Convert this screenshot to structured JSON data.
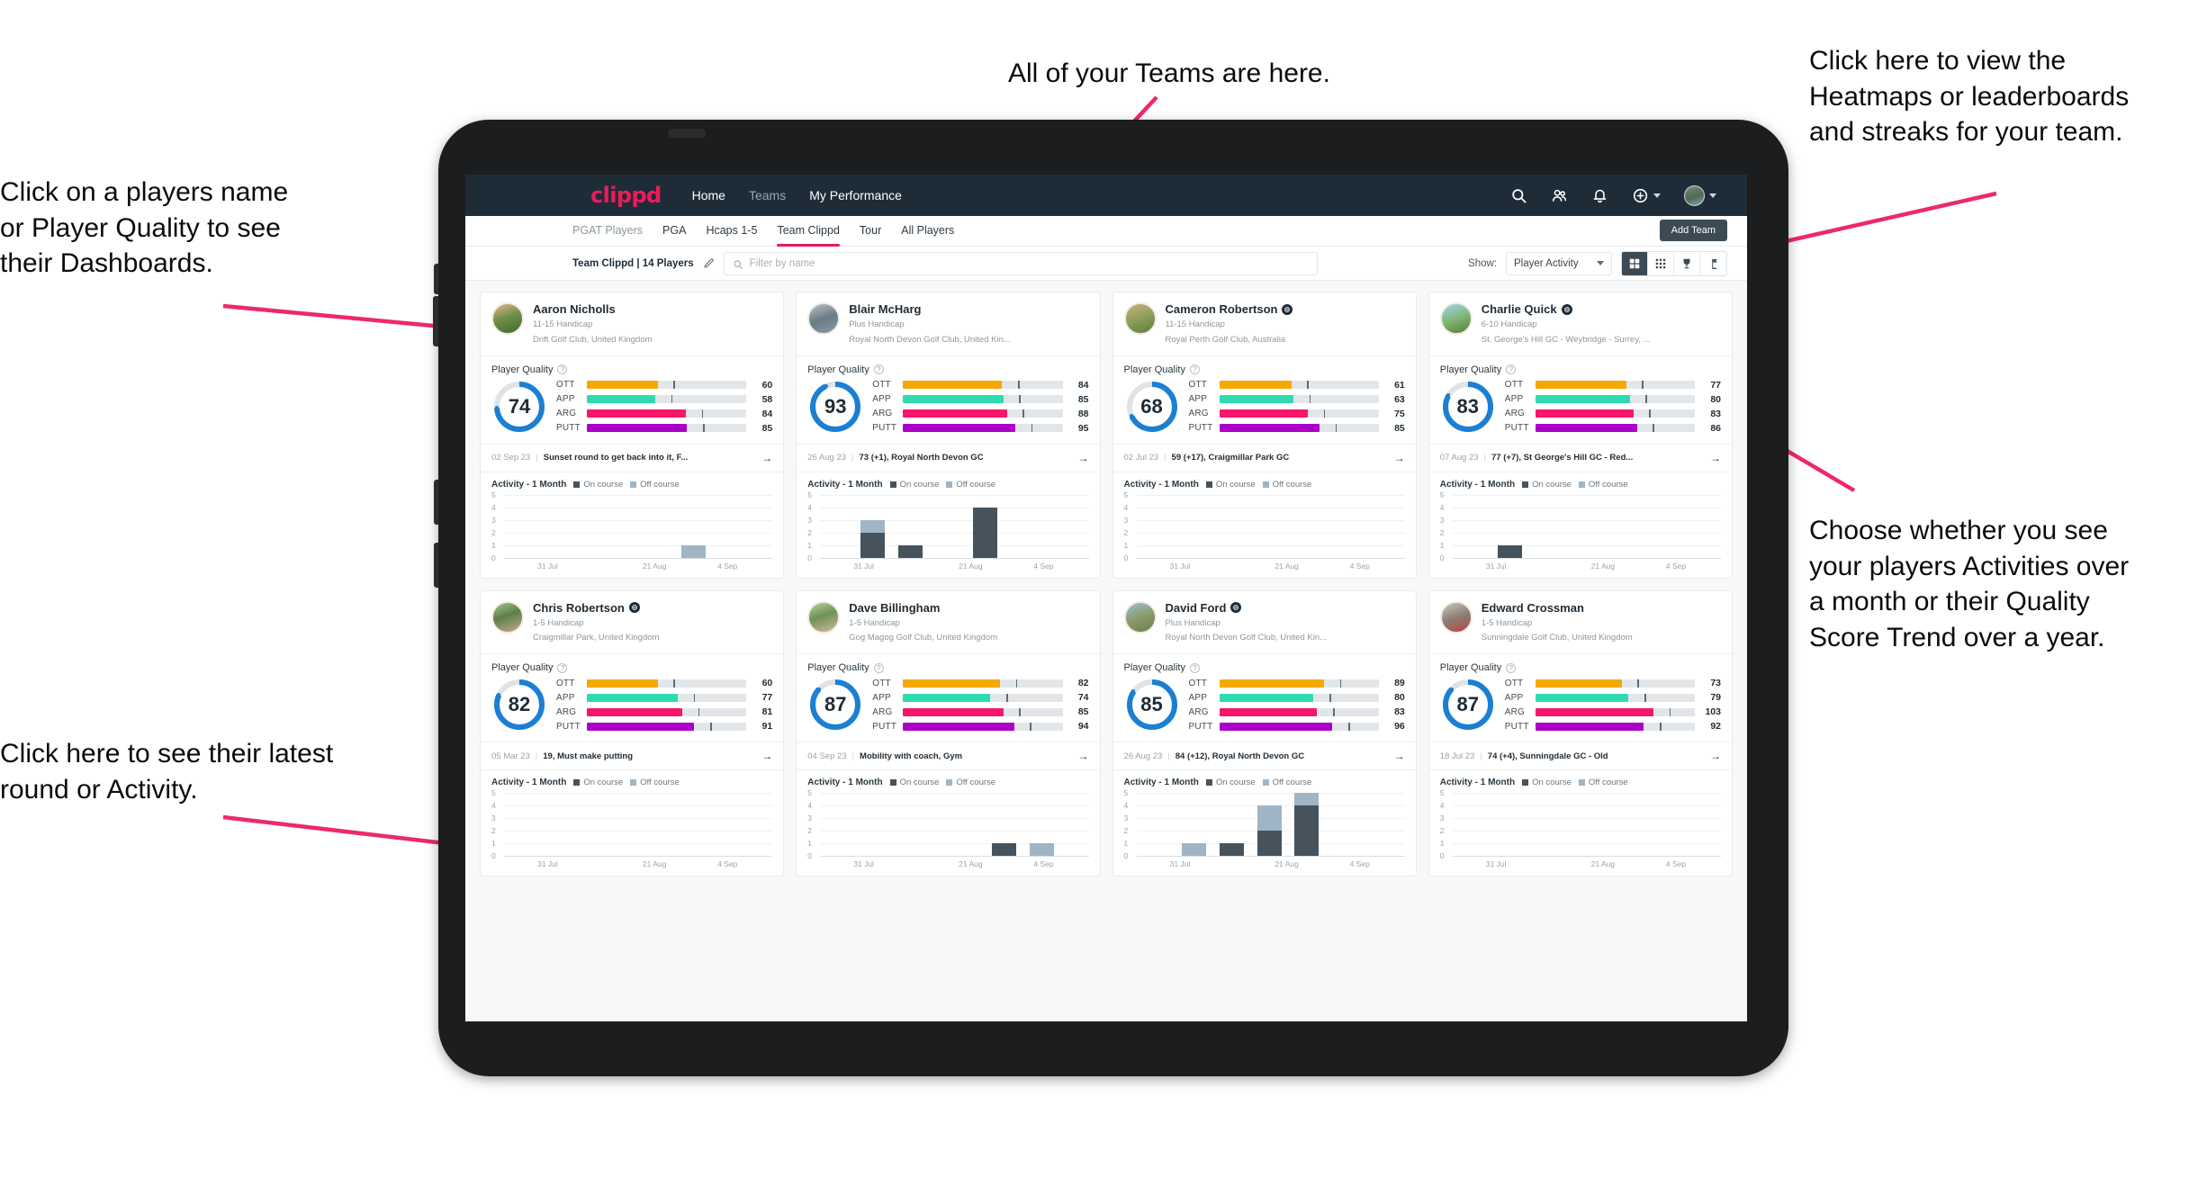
{
  "annotations": [
    {
      "id": "a1",
      "text": "Click on a players name\nor Player Quality to see\ntheir Dashboards."
    },
    {
      "id": "a2",
      "text": "All of your Teams are here."
    },
    {
      "id": "a3",
      "text": "Click here to view the\nHeatmaps or leaderboards\nand streaks for your team."
    },
    {
      "id": "a4",
      "text": "Choose whether you see\nyour players Activities over\na month or their Quality\nScore Trend over a year."
    },
    {
      "id": "a5",
      "text": "Click here to see their latest\nround or Activity."
    }
  ],
  "topnav": {
    "brand": "clippd",
    "links": [
      {
        "label": "Home",
        "active": true
      },
      {
        "label": "Teams",
        "active": false
      },
      {
        "label": "My Performance",
        "active": true
      }
    ],
    "icons": [
      "search-icon",
      "people-icon",
      "bell-icon",
      "plus-circle-icon",
      "avatar"
    ]
  },
  "tabs": [
    {
      "label": "PGAT Players",
      "active": false
    },
    {
      "label": "PGA",
      "active": false
    },
    {
      "label": "Hcaps 1-5",
      "active": false
    },
    {
      "label": "Team Clippd",
      "active": true
    },
    {
      "label": "Tour",
      "active": false
    },
    {
      "label": "All Players",
      "active": false
    }
  ],
  "add_team_label": "Add Team",
  "toolbar": {
    "team_label": "Team Clippd | 14 Players",
    "edit_icon": "pencil-icon",
    "search_placeholder": "Filter by name",
    "show_label": "Show:",
    "show_value": "Player Activity",
    "views": [
      {
        "name": "grid-view",
        "icon": "grid-large-icon",
        "active": true
      },
      {
        "name": "dense-grid-view",
        "icon": "grid-small-icon",
        "active": false
      },
      {
        "name": "leaderboard-view",
        "icon": "trophy-icon",
        "active": false
      },
      {
        "name": "heatmap-view",
        "icon": "flag-icon",
        "active": false
      }
    ]
  },
  "metric_colors": {
    "OTT": "#f5a800",
    "APP": "#2edbb0",
    "ARG": "#f5176a",
    "PUTT": "#aa00c7",
    "ring": "#1b7fd4"
  },
  "activity": {
    "title": "Activity - 1 Month",
    "legend_on": "On course",
    "legend_off": "Off course",
    "yticks": [
      "5",
      "4",
      "3",
      "2",
      "1",
      "0"
    ],
    "xticks": [
      "31 Jul",
      "21 Aug",
      "4 Sep"
    ],
    "ymax": 5
  },
  "player_quality_label": "Player Quality",
  "players": [
    {
      "name": "Aaron Nicholls",
      "verified": false,
      "handicap": "11-15 Handicap",
      "club": "Drift Golf Club, United Kingdom",
      "avatar": "linear-gradient(160deg,#e8b98a,#6f8f4a 45%,#3f6b2f)",
      "score": 74,
      "metrics": [
        {
          "label": "OTT",
          "value": 60
        },
        {
          "label": "APP",
          "value": 58
        },
        {
          "label": "ARG",
          "value": 84
        },
        {
          "label": "PUTT",
          "value": 85
        }
      ],
      "round": {
        "date": "02 Sep 23",
        "text": "Sunset round to get back into it, F..."
      },
      "bars": [
        {
          "x": 0.66,
          "on": 0,
          "off": 1
        }
      ]
    },
    {
      "name": "Blair McHarg",
      "verified": false,
      "handicap": "Plus Handicap",
      "club": "Royal North Devon Golf Club, United Kin...",
      "avatar": "linear-gradient(160deg,#b9c6cf,#6c7a84 50%,#8a9aa4)",
      "score": 93,
      "metrics": [
        {
          "label": "OTT",
          "value": 84
        },
        {
          "label": "APP",
          "value": 85
        },
        {
          "label": "ARG",
          "value": 88
        },
        {
          "label": "PUTT",
          "value": 95
        }
      ],
      "round": {
        "date": "26 Aug 23",
        "text": "73 (+1), Royal North Devon GC"
      },
      "bars": [
        {
          "x": 0.15,
          "on": 2,
          "off": 1
        },
        {
          "x": 0.29,
          "on": 1,
          "off": 0
        },
        {
          "x": 0.57,
          "on": 4,
          "off": 0
        }
      ]
    },
    {
      "name": "Cameron Robertson",
      "verified": true,
      "handicap": "11-15 Handicap",
      "club": "Royal Perth Golf Club, Australia",
      "avatar": "linear-gradient(160deg,#cbb07a,#8aa05a 50%,#5e7a3c)",
      "score": 68,
      "metrics": [
        {
          "label": "OTT",
          "value": 61
        },
        {
          "label": "APP",
          "value": 63
        },
        {
          "label": "ARG",
          "value": 75
        },
        {
          "label": "PUTT",
          "value": 85
        }
      ],
      "round": {
        "date": "02 Jul 23",
        "text": "59 (+17), Craigmillar Park GC"
      },
      "bars": []
    },
    {
      "name": "Charlie Quick",
      "verified": true,
      "handicap": "6-10 Handicap",
      "club": "St. George's Hill GC - Weybridge - Surrey, ...",
      "avatar": "linear-gradient(160deg,#9fd4ef,#7fb26a 55%,#4e7d3d)",
      "score": 83,
      "metrics": [
        {
          "label": "OTT",
          "value": 77
        },
        {
          "label": "APP",
          "value": 80
        },
        {
          "label": "ARG",
          "value": 83
        },
        {
          "label": "PUTT",
          "value": 86
        }
      ],
      "round": {
        "date": "07 Aug 23",
        "text": "77 (+7), St George's Hill GC - Red..."
      },
      "bars": [
        {
          "x": 0.17,
          "on": 1,
          "off": 0
        }
      ]
    },
    {
      "name": "Chris Robertson",
      "verified": true,
      "handicap": "1-5 Handicap",
      "club": "Craigmillar Park, United Kingdom",
      "avatar": "linear-gradient(160deg,#9ec98a,#5d7f4b 45%,#c8a98c)",
      "score": 82,
      "metrics": [
        {
          "label": "OTT",
          "value": 60
        },
        {
          "label": "APP",
          "value": 77
        },
        {
          "label": "ARG",
          "value": 81
        },
        {
          "label": "PUTT",
          "value": 91
        }
      ],
      "round": {
        "date": "05 Mar 23",
        "text": "19, Must make putting"
      },
      "bars": []
    },
    {
      "name": "Dave Billingham",
      "verified": false,
      "handicap": "1-5 Handicap",
      "club": "Gog Magog Golf Club, United Kingdom",
      "avatar": "linear-gradient(160deg,#b5d39a,#6f9257 45%,#d5b89a)",
      "score": 87,
      "metrics": [
        {
          "label": "OTT",
          "value": 82
        },
        {
          "label": "APP",
          "value": 74
        },
        {
          "label": "ARG",
          "value": 85
        },
        {
          "label": "PUTT",
          "value": 94
        }
      ],
      "round": {
        "date": "04 Sep 23",
        "text": "Mobility with coach, Gym"
      },
      "bars": [
        {
          "x": 0.64,
          "on": 1,
          "off": 0
        },
        {
          "x": 0.78,
          "on": 0,
          "off": 1
        }
      ]
    },
    {
      "name": "David Ford",
      "verified": true,
      "handicap": "Plus Handicap",
      "club": "Royal North Devon Golf Club, United Kin...",
      "avatar": "linear-gradient(160deg,#9dbfd6,#8a9a6a 50%,#6d7f4c)",
      "score": 85,
      "metrics": [
        {
          "label": "OTT",
          "value": 89
        },
        {
          "label": "APP",
          "value": 80
        },
        {
          "label": "ARG",
          "value": 83
        },
        {
          "label": "PUTT",
          "value": 96
        }
      ],
      "round": {
        "date": "26 Aug 23",
        "text": "84 (+12), Royal North Devon GC"
      },
      "bars": [
        {
          "x": 0.17,
          "on": 0,
          "off": 1
        },
        {
          "x": 0.31,
          "on": 1,
          "off": 0
        },
        {
          "x": 0.45,
          "on": 2,
          "off": 2
        },
        {
          "x": 0.59,
          "on": 4,
          "off": 1
        }
      ]
    },
    {
      "name": "Edward Crossman",
      "verified": false,
      "handicap": "1-5 Handicap",
      "club": "Sunningdale Golf Club, United Kingdom",
      "avatar": "linear-gradient(160deg,#cfc7bd,#8b7f74 50%,#b6453f)",
      "score": 87,
      "metrics": [
        {
          "label": "OTT",
          "value": 73
        },
        {
          "label": "APP",
          "value": 79
        },
        {
          "label": "ARG",
          "value": 103
        },
        {
          "label": "PUTT",
          "value": 92
        }
      ],
      "round": {
        "date": "18 Jul 23",
        "text": "74 (+4), Sunningdale GC - Old"
      },
      "bars": []
    }
  ]
}
